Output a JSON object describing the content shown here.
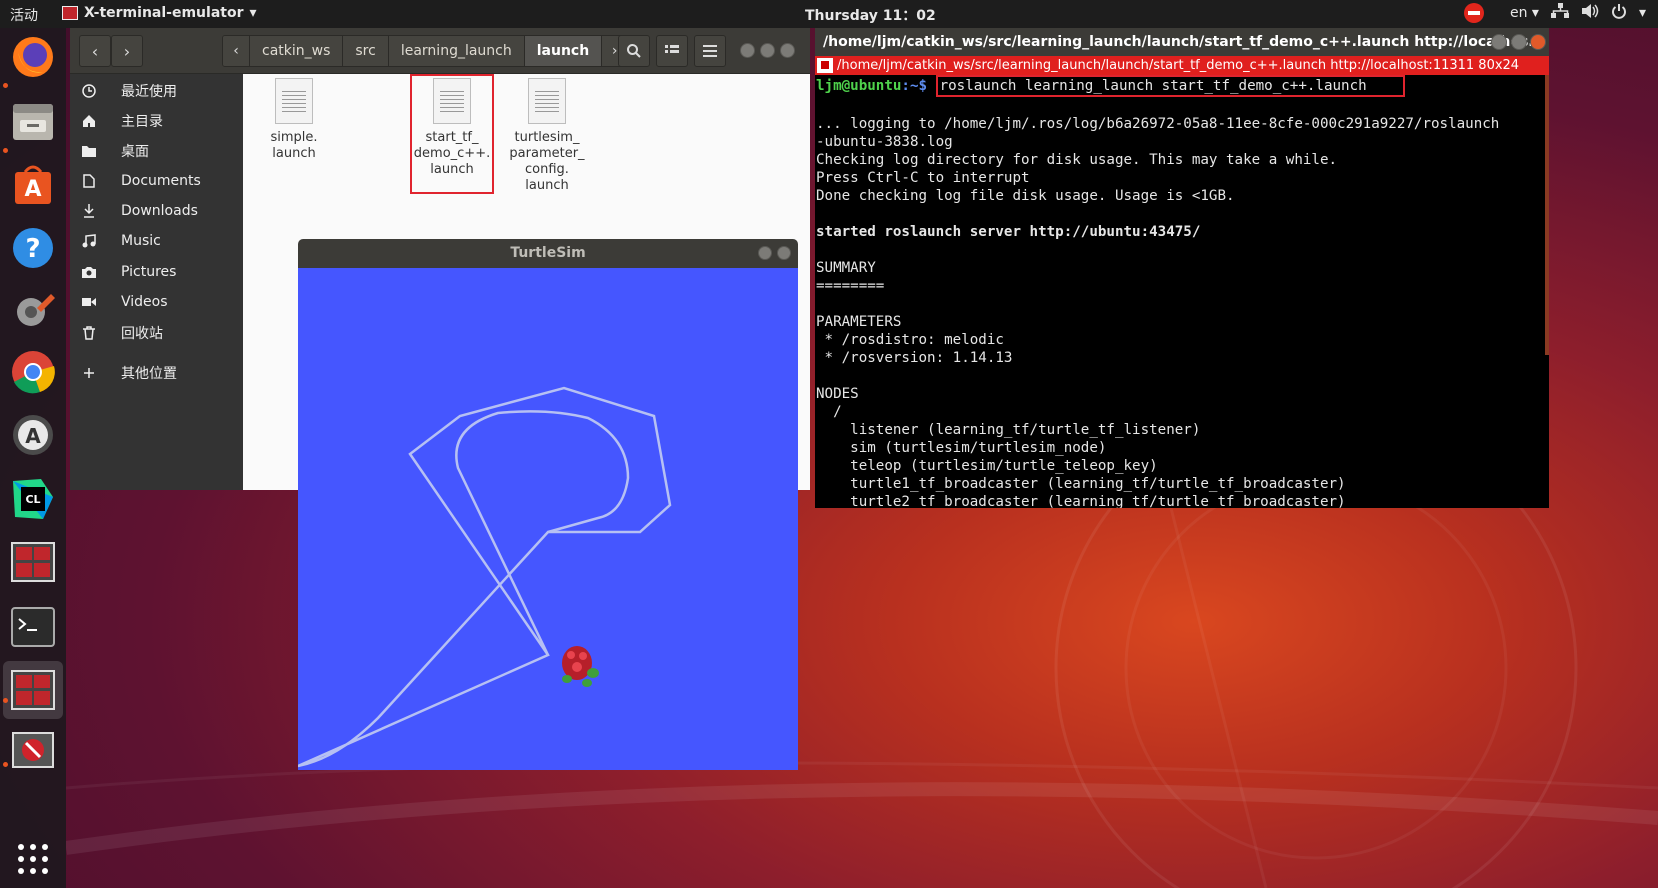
{
  "topbar": {
    "activities": "活动",
    "app_name": "X-terminal-emulator",
    "clock": "Thursday 11：02",
    "lang": "en"
  },
  "dock": {
    "items": [
      "firefox-icon",
      "files-icon",
      "software-center-icon",
      "help-icon",
      "settings-icon",
      "chrome-icon",
      "software-updater-icon",
      "clion-icon",
      "terminator-icon",
      "terminal-icon",
      "terminator-active-icon",
      "no-entry-icon",
      "app-grid-icon"
    ]
  },
  "file_manager": {
    "breadcrumbs": [
      "catkin_ws",
      "src",
      "learning_launch",
      "launch"
    ],
    "sidebar": [
      {
        "icon": "clock-icon",
        "label": "最近使用"
      },
      {
        "icon": "home-icon",
        "label": "主目录"
      },
      {
        "icon": "folder-icon",
        "label": "桌面"
      },
      {
        "icon": "document-icon",
        "label": "Documents"
      },
      {
        "icon": "download-icon",
        "label": "Downloads"
      },
      {
        "icon": "music-icon",
        "label": "Music"
      },
      {
        "icon": "camera-icon",
        "label": "Pictures"
      },
      {
        "icon": "video-icon",
        "label": "Videos"
      },
      {
        "icon": "trash-icon",
        "label": "回收站"
      },
      {
        "icon": "plus-icon",
        "label": "其他位置"
      }
    ],
    "files": [
      {
        "line1": "simple.",
        "line2": "launch",
        "line3": "",
        "line4": ""
      },
      {
        "line1": "start_tf_",
        "line2": "demo_c++.",
        "line3": "launch",
        "line4": ""
      },
      {
        "line1": "turtlesim_",
        "line2": "parameter_",
        "line3": "config.",
        "line4": "launch"
      }
    ]
  },
  "turtlesim": {
    "title": "TurtleSim",
    "background": "#4556ff"
  },
  "terminal": {
    "title": "/home/ljm/catkin_ws/src/learning_launch/launch/start_tf_demo_c++.launch http://localhos...",
    "tab": "/home/ljm/catkin_ws/src/learning_launch/launch/start_tf_demo_c++.launch http://localhost:11311 80x24",
    "prompt_user": "ljm@ubuntu",
    "prompt_path": ":~$",
    "command": "roslaunch learning_launch start_tf_demo_c++.launch",
    "lines": [
      "",
      "... logging to /home/ljm/.ros/log/b6a26972-05a8-11ee-8cfe-000c291a9227/roslaunch",
      "-ubuntu-3838.log",
      "Checking log directory for disk usage. This may take a while.",
      "Press Ctrl-C to interrupt",
      "Done checking log file disk usage. Usage is <1GB.",
      "",
      "started roslaunch server http://ubuntu:43475/",
      "",
      "SUMMARY",
      "========",
      "",
      "PARAMETERS",
      " * /rosdistro: melodic",
      " * /rosversion: 1.14.13",
      "",
      "NODES",
      "  /",
      "    listener (learning_tf/turtle_tf_listener)",
      "    sim (turtlesim/turtlesim_node)",
      "    teleop (turtlesim/turtle_teleop_key)",
      "    turtle1_tf_broadcaster (learning_tf/turtle_tf_broadcaster)",
      "    turtle2_tf_broadcaster (learning_tf/turtle_tf_broadcaster)"
    ]
  }
}
